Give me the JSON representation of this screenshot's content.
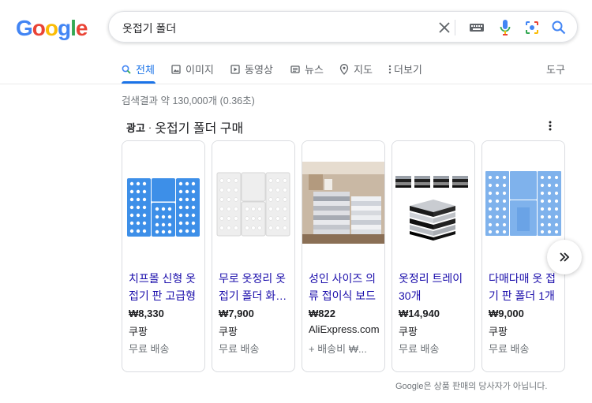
{
  "logo": {
    "letters": [
      "G",
      "o",
      "o",
      "g",
      "l",
      "e"
    ],
    "colors": [
      "#4285F4",
      "#EA4335",
      "#FBBC05",
      "#4285F4",
      "#34A853",
      "#EA4335"
    ]
  },
  "search": {
    "query": "옷접기 폴더"
  },
  "tabs": [
    {
      "label": "전체",
      "icon": "search-icon",
      "active": true
    },
    {
      "label": "이미지",
      "icon": "image-icon"
    },
    {
      "label": "동영상",
      "icon": "video-icon"
    },
    {
      "label": "뉴스",
      "icon": "news-icon"
    },
    {
      "label": "지도",
      "icon": "map-pin-icon"
    },
    {
      "label": "더보기",
      "icon": "more-vert-icon"
    }
  ],
  "tools_label": "도구",
  "result_stats": "검색결과 약 130,000개 (0.36초)",
  "ads": {
    "label": "광고",
    "separator": "·",
    "heading": "옷접기 폴더 구매",
    "products": [
      {
        "title": "치프몰 신형 옷접기 판 고급형",
        "price": "₩8,330",
        "seller": "쿠팡",
        "shipping": "무료 배송",
        "image": "blue-folding-board"
      },
      {
        "title": "무로 옷정리 옷접기 폴더 화이트",
        "price": "₩7,900",
        "seller": "쿠팡",
        "shipping": "무료 배송",
        "image": "white-folding-board"
      },
      {
        "title": "성인 사이즈 의류 접이식 보드",
        "price": "₩822",
        "seller": "AliExpress.com",
        "shipping": "+ 배송비 ₩...",
        "image": "folded-clothes-shelf"
      },
      {
        "title": "옷정리 트레이 30개",
        "price": "₩14,940",
        "seller": "쿠팡",
        "shipping": "무료 배송",
        "image": "stacked-trays"
      },
      {
        "title": "다매다매 옷 접기 판 폴더 1개",
        "price": "₩9,000",
        "seller": "쿠팡",
        "shipping": "무료 배송",
        "image": "light-blue-folding-board"
      }
    ]
  },
  "footer_note": "Google은 상품 판매의 당사자가 아닙니다."
}
